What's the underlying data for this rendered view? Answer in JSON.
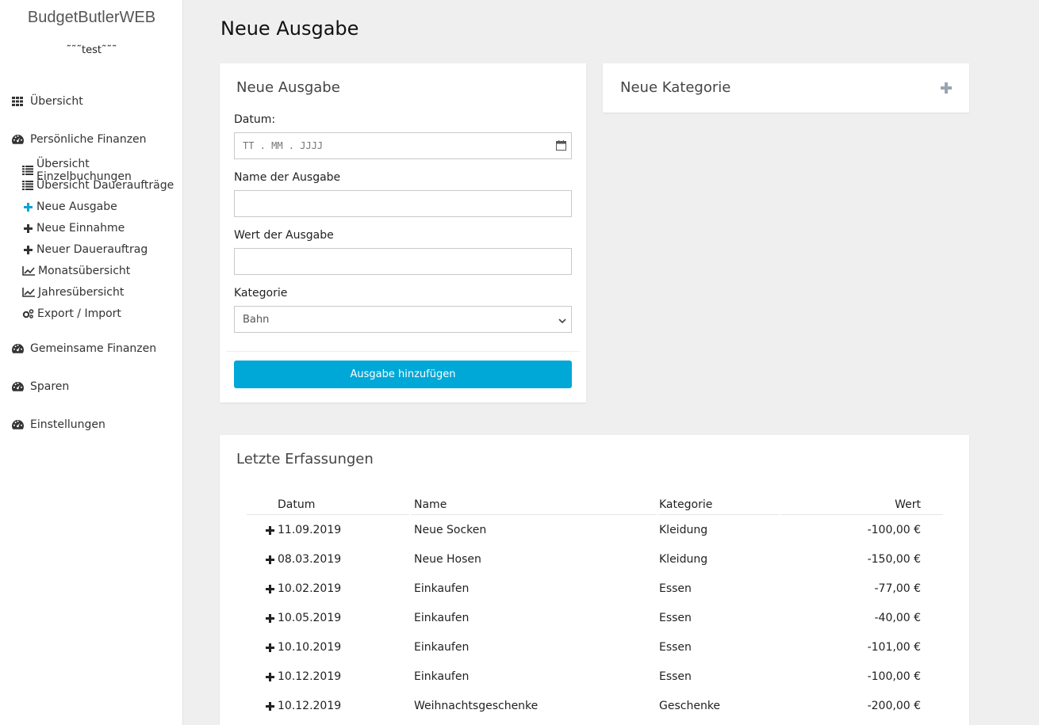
{
  "app": {
    "brand": "BudgetButlerWEB",
    "user": "˜˜˜test˜˜˜"
  },
  "sidebar": {
    "top_items": [
      {
        "label": "Übersicht",
        "icon": "grid-icon"
      },
      {
        "label": "Persönliche Finanzen",
        "icon": "dashboard-icon"
      },
      {
        "label": "Gemeinsame Finanzen",
        "icon": "dashboard-icon"
      },
      {
        "label": "Sparen",
        "icon": "dashboard-icon"
      },
      {
        "label": "Einstellungen",
        "icon": "dashboard-icon"
      }
    ],
    "sub_items": [
      {
        "label": "Übersicht Einzelbuchungen",
        "icon": "list-icon"
      },
      {
        "label": "Übersicht Daueraufträge",
        "icon": "list-icon"
      },
      {
        "label": "Neue Ausgabe",
        "icon": "plus-icon",
        "active": true
      },
      {
        "label": "Neue Einnahme",
        "icon": "plus-icon"
      },
      {
        "label": "Neuer Dauerauftrag",
        "icon": "plus-icon"
      },
      {
        "label": "Monatsübersicht",
        "icon": "chart-line-icon"
      },
      {
        "label": "Jahresübersicht",
        "icon": "chart-line-icon"
      },
      {
        "label": "Export / Import",
        "icon": "cogs-icon"
      }
    ]
  },
  "main": {
    "page_title": "Neue Ausgabe",
    "form": {
      "title": "Neue Ausgabe",
      "date_label": "Datum:",
      "date_placeholder": "TT . MM . JJJJ",
      "name_label": "Name der Ausgabe",
      "name_value": "",
      "value_label": "Wert der Ausgabe",
      "value_value": "",
      "category_label": "Kategorie",
      "category_selected": "Bahn",
      "submit_label": "Ausgabe hinzufügen"
    },
    "new_category": {
      "title": "Neue Kategorie"
    },
    "recent": {
      "title": "Letzte Erfassungen",
      "columns": [
        "Datum",
        "Name",
        "Kategorie",
        "Wert"
      ],
      "rows": [
        {
          "date": "11.09.2019",
          "name": "Neue Socken",
          "category": "Kleidung",
          "value": "-100,00 €"
        },
        {
          "date": "08.03.2019",
          "name": "Neue Hosen",
          "category": "Kleidung",
          "value": "-150,00 €"
        },
        {
          "date": "10.02.2019",
          "name": "Einkaufen",
          "category": "Essen",
          "value": "-77,00 €"
        },
        {
          "date": "10.05.2019",
          "name": "Einkaufen",
          "category": "Essen",
          "value": "-40,00 €"
        },
        {
          "date": "10.10.2019",
          "name": "Einkaufen",
          "category": "Essen",
          "value": "-101,00 €"
        },
        {
          "date": "10.12.2019",
          "name": "Einkaufen",
          "category": "Essen",
          "value": "-100,00 €"
        },
        {
          "date": "10.12.2019",
          "name": "Weihnachtsgeschenke",
          "category": "Geschenke",
          "value": "-200,00 €"
        }
      ]
    }
  },
  "colors": {
    "accent": "#00a8d8",
    "background": "#efefef"
  }
}
